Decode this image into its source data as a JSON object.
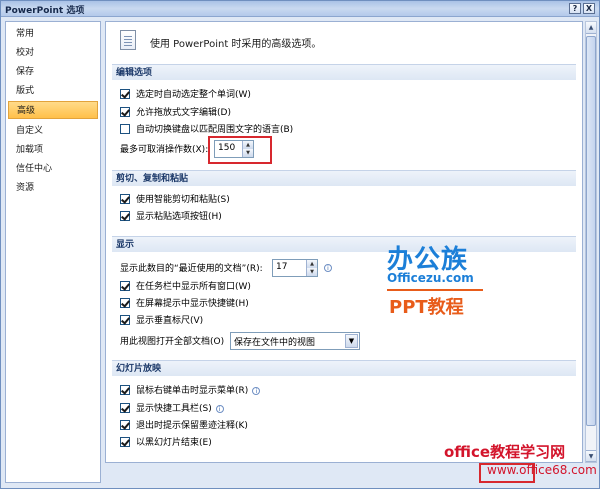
{
  "window": {
    "title": "PowerPoint 选项",
    "help_btn": "?",
    "close_btn": "X"
  },
  "sidebar": {
    "items": [
      {
        "label": "常用"
      },
      {
        "label": "校对"
      },
      {
        "label": "保存"
      },
      {
        "label": "版式"
      },
      {
        "label": "高级",
        "selected": true
      },
      {
        "label": "自定义"
      },
      {
        "label": "加载项"
      },
      {
        "label": "信任中心"
      },
      {
        "label": "资源"
      }
    ]
  },
  "header": {
    "text": "使用 PowerPoint 时采用的高级选项。",
    "icon": "document-icon"
  },
  "sections": {
    "edit": {
      "title": "编辑选项",
      "opt1": "选定时自动选定整个单词(W)",
      "opt2": "允许拖放式文字编辑(D)",
      "opt3": "自动切换键盘以匹配周围文字的语言(B)",
      "undo_label": "最多可取消操作数(X):",
      "undo_value": "150"
    },
    "clipboard": {
      "title": "剪切、复制和粘贴",
      "opt1": "使用智能剪切和粘贴(S)",
      "opt2": "显示粘贴选项按钮(H)"
    },
    "display": {
      "title": "显示",
      "recent_label": "显示此数目的“最近使用的文档”(R):",
      "recent_value": "17",
      "opt1": "在任务栏中显示所有窗口(W)",
      "opt2": "在屏幕提示中显示快捷键(H)",
      "opt3": "显示垂直标尺(V)",
      "view_label": "用此视图打开全部文档(O)",
      "view_value": "保存在文件中的视图"
    },
    "slideshow": {
      "title": "幻灯片放映",
      "opt1": "鼠标右键单击时显示菜单(R)",
      "opt2": "显示快捷工具栏(S)",
      "opt3": "退出时提示保留墨迹注释(K)",
      "opt4": "以黑幻灯片结束(E)"
    }
  },
  "watermark": {
    "logo": "办公族",
    "domain": "Officezu.com",
    "ppt": "PPT教程",
    "bottom1": "office教程学习网",
    "bottom2": "www.office68.com"
  },
  "colors": {
    "accent": "#1c5180",
    "selected": "#ffc04a",
    "highlight": "#d7282e"
  }
}
